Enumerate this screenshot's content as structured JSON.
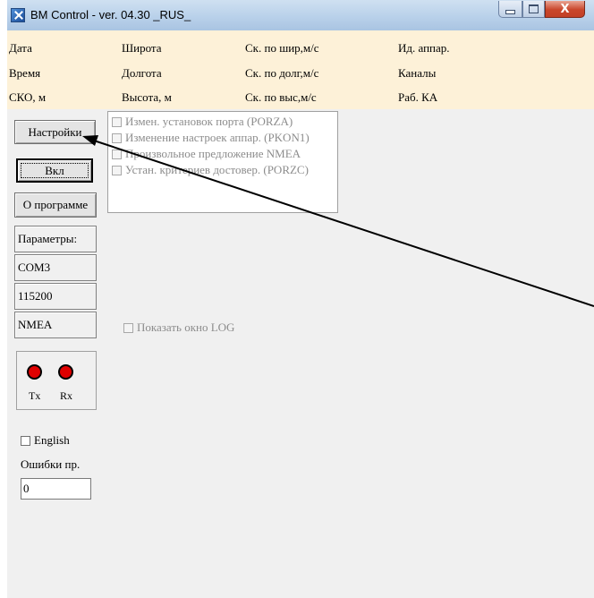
{
  "window": {
    "title": "BM Control - ver. 04.30 _RUS_",
    "close_glyph": "X"
  },
  "header": {
    "col1": [
      "Дата",
      "Время",
      "СКО, м"
    ],
    "col2": [
      "Широта",
      "Долгота",
      "Высота, м"
    ],
    "col3": [
      "Ск. по шир,м/с",
      "Ск. по долг,м/с",
      "Ск. по выс,м/с"
    ],
    "col4": [
      "Ид. аппар.",
      "Каналы",
      "Раб. КА"
    ]
  },
  "left_panel": {
    "settings_button": "Настройки",
    "on_button": "Вкл",
    "about_button": "О программе",
    "params_label": "Параметры:",
    "port": "COM3",
    "baud": "115200",
    "protocol": "NMEA",
    "tx_label": "Tx",
    "rx_label": "Rx",
    "english_label": "English",
    "errors_label": "Ошибки пр.",
    "errors_value": "0"
  },
  "options": [
    "Измен. установок порта (PORZA)",
    "Изменение настроек аппар. (PKON1)",
    "Произвольное предложение NMEA",
    "Устан. критериев достовер. (PORZC)"
  ],
  "log_checkbox_label": "Показать окно LOG",
  "colors": {
    "header_bg": "#fdf1d8",
    "client_bg": "#f0f0f0",
    "led": "#e00000",
    "disabled_text": "#8c8c8c"
  },
  "icons": [
    "app-icon",
    "minimize-icon",
    "maximize-icon",
    "close-icon",
    "arrow-annotation"
  ]
}
